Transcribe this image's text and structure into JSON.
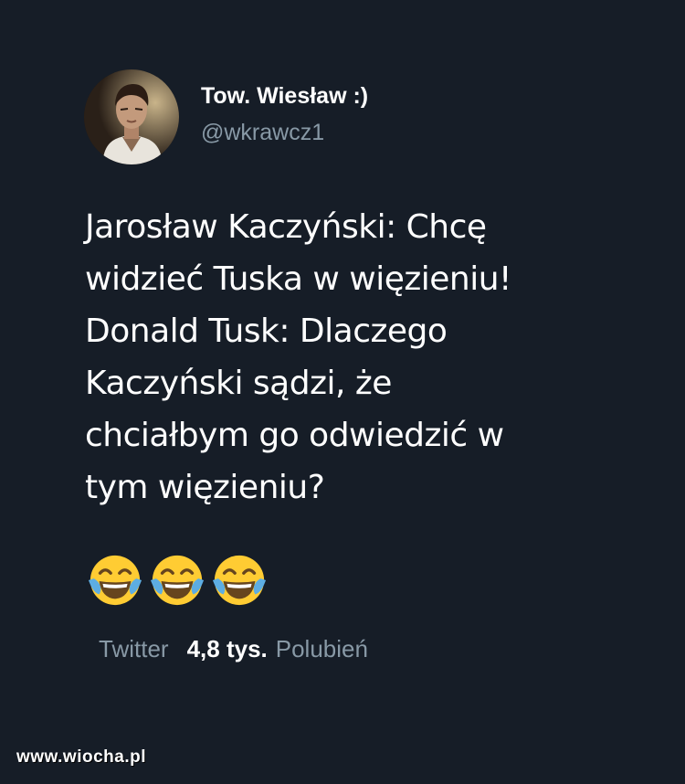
{
  "user": {
    "display_name": "Tow. Wiesław :)",
    "handle": "@wkrawcz1",
    "avatar_icon": "profile-photo"
  },
  "tweet": {
    "lines": [
      "Jarosław Kaczyński: Chcę",
      "widzieć Tuska w więzieniu!",
      "Donald Tusk: Dlaczego",
      "Kaczyński sądzi, że",
      "chciałbym go odwiedzić w",
      "tym więzieniu?"
    ],
    "emojis": [
      "face-with-tears-of-joy",
      "face-with-tears-of-joy",
      "face-with-tears-of-joy"
    ]
  },
  "meta": {
    "source": "Twitter",
    "likes_count": "4,8 tys.",
    "likes_label": "Polubień"
  },
  "watermark": "www.wiocha.pl",
  "colors": {
    "background": "#161d27",
    "primary_text": "#ffffff",
    "secondary_text": "#8899a6",
    "emoji_yellow": "#ffcc33",
    "emoji_tear": "#5dade2"
  }
}
